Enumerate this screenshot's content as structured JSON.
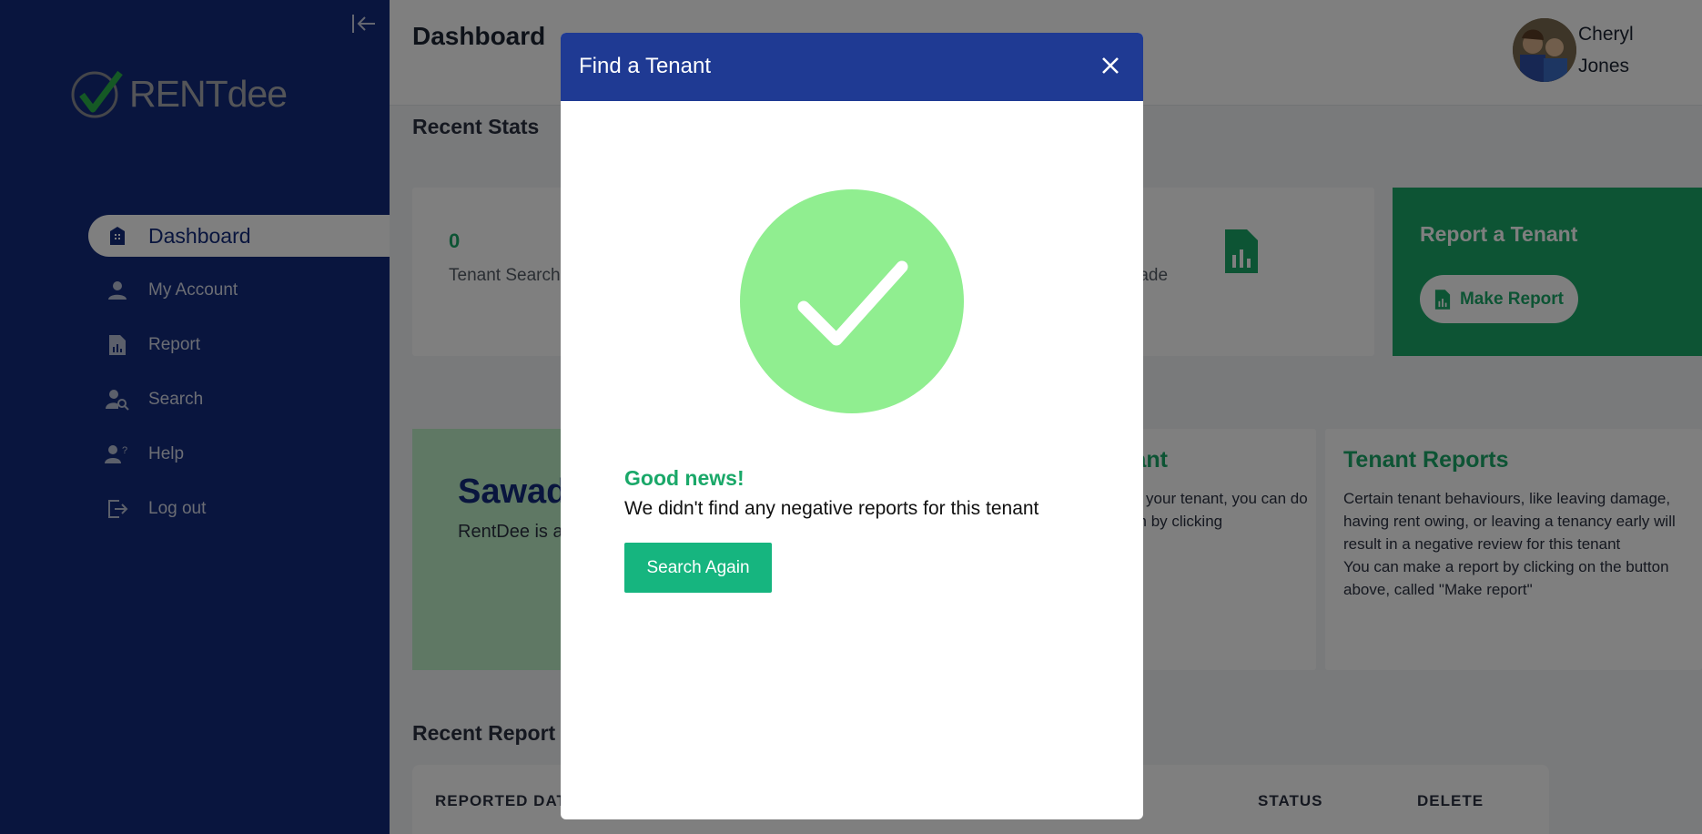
{
  "sidebar": {
    "logo_text": "RENTdee",
    "items": [
      {
        "label": "Dashboard",
        "icon": "building-icon",
        "active": true
      },
      {
        "label": "My Account",
        "icon": "user-icon"
      },
      {
        "label": "Report",
        "icon": "report-file-icon"
      },
      {
        "label": "Search",
        "icon": "user-search-icon"
      },
      {
        "label": "Help",
        "icon": "user-help-icon"
      },
      {
        "label": "Log out",
        "icon": "logout-icon"
      }
    ]
  },
  "header": {
    "title": "Dashboard",
    "user_first": "Cheryl",
    "user_last": "Jones"
  },
  "stats": {
    "section_title": "Recent Stats",
    "tenant_searches_value": "0",
    "tenant_searches_label": "Tenant Search",
    "reports_made_label": "ports Made"
  },
  "report_card": {
    "title": "Report a Tenant",
    "button_label": "Make Report"
  },
  "welcome": {
    "heading": "Sawad",
    "body": "RentDee is a for landords decisions e tenants."
  },
  "info_cards": [
    {
      "title": "tenant",
      "body": "enting your tenant, you can do n them by clicking"
    },
    {
      "title": "Tenant Reports",
      "body": "Certain tenant behaviours, like leaving damage, having rent owing, or leaving a tenancy early will result in a negative review for this tenant\nYou can make a report by clicking on the button above, called \"Make report\""
    }
  ],
  "reports": {
    "section_title": "Recent Report",
    "columns": [
      "REPORTED DAT",
      "STATUS",
      "DELETE"
    ]
  },
  "modal": {
    "title": "Find a Tenant",
    "success_heading": "Good news!",
    "message": "We didn't find any negative reports for this tenant",
    "button_label": "Search Again"
  },
  "colors": {
    "sidebar": "#132a7c",
    "modal_header": "#1f3a93",
    "accent_green": "#1aa869",
    "success_circle": "#90ee90"
  }
}
